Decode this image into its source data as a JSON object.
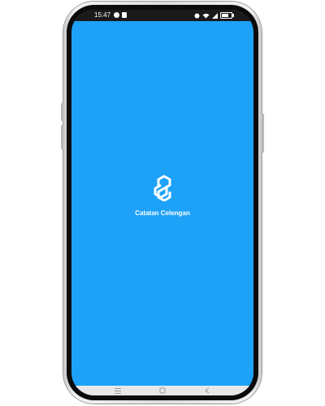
{
  "status_bar": {
    "time": "15:47",
    "left_icons": [
      "notification-icon",
      "media-icon"
    ],
    "right_icons": [
      "alarm-icon",
      "wifi-icon",
      "signal-icon",
      "battery-icon"
    ]
  },
  "splash": {
    "logo_icon": "catatan-celengan-logo-icon",
    "app_name": "Catatan Celengan",
    "background_color": "#1ea2f8",
    "text_color": "#ffffff"
  },
  "nav_bar": {
    "buttons": [
      "menu-icon",
      "home-icon",
      "back-icon"
    ]
  }
}
